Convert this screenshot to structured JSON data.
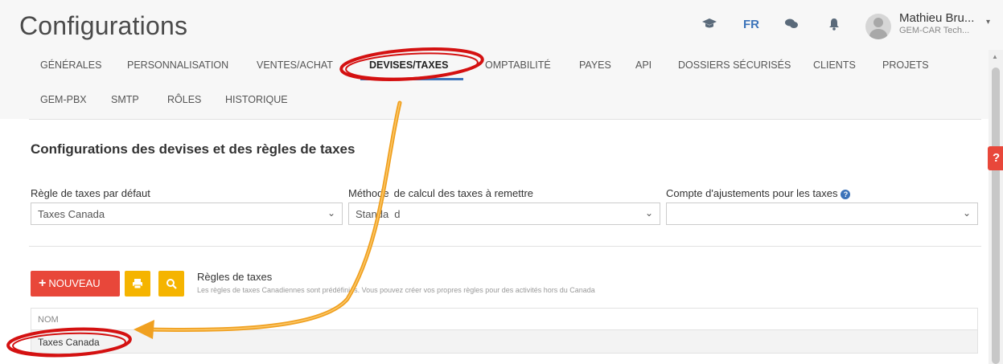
{
  "header": {
    "title": "Configurations",
    "lang": "FR",
    "user_name": "Mathieu Bru...",
    "user_company": "GEM-CAR Tech...",
    "icons": [
      "graduation-cap-icon",
      "chat-icon",
      "bell-icon",
      "chevron-down-icon"
    ]
  },
  "tabs": {
    "row1": [
      {
        "label": "GÉNÉRALES"
      },
      {
        "label": "PERSONNALISATION"
      },
      {
        "label": "VENTES/ACHAT"
      },
      {
        "label": "DEVISES/TAXES"
      },
      {
        "label": "OMPTABILITÉ"
      },
      {
        "label": "PAYES"
      },
      {
        "label": "API"
      },
      {
        "label": "DOSSIERS SÉCURISÉS"
      },
      {
        "label": "CLIENTS"
      },
      {
        "label": "PROJETS"
      }
    ],
    "row2": [
      {
        "label": "GEM-PBX"
      },
      {
        "label": "SMTP"
      },
      {
        "label": "RÔLES"
      },
      {
        "label": "HISTORIQUE"
      }
    ],
    "active": "DEVISES/TAXES"
  },
  "section": {
    "title": "Configurations des devises et des règles de taxes"
  },
  "fields": {
    "default_rule_label": "Règle de taxes par défaut",
    "default_rule_value": "Taxes Canada",
    "calc_method_label_a": "Méthode",
    "calc_method_label_b": "de calcul des taxes à remettre",
    "calc_method_value_a": "Standa",
    "calc_method_value_b": "d",
    "adjust_account_label": "Compte d'ajustements pour les taxes",
    "adjust_account_value": ""
  },
  "rules": {
    "new_button": "NOUVEAU",
    "title": "Règles de taxes",
    "subtitle": "Les règles de taxes Canadiennes sont prédéfinies. Vous pouvez créer vos propres règles pour des activités hors du Canada",
    "column_name": "NOM",
    "rows": [
      {
        "name": "Taxes Canada"
      }
    ]
  },
  "help_button": "?",
  "colors": {
    "accent": "#3b73b9",
    "danger": "#e8473a",
    "warning": "#f5b400",
    "annotation_red": "#d41111",
    "annotation_orange": "#f0a020"
  }
}
